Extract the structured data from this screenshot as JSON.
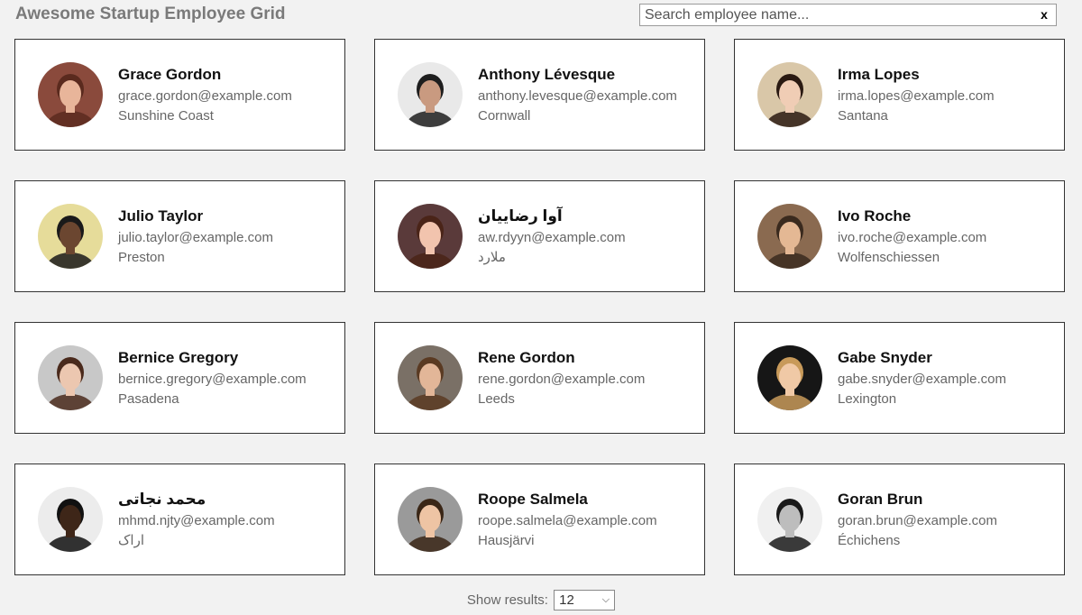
{
  "header": {
    "title": "Awesome Startup Employee Grid",
    "search_placeholder": "Search employee name...",
    "clear_label": "x"
  },
  "employees": [
    {
      "name": "Grace Gordon",
      "email": "grace.gordon@example.com",
      "city": "Sunshine Coast",
      "bg": "#8a4a3c",
      "skin": "#e8b59a",
      "hair": "#5a2a1e"
    },
    {
      "name": "Anthony Lévesque",
      "email": "anthony.levesque@example.com",
      "city": "Cornwall",
      "bg": "#e9e9e9",
      "skin": "#c99a80",
      "hair": "#1e1e1e"
    },
    {
      "name": "Irma Lopes",
      "email": "irma.lopes@example.com",
      "city": "Santana",
      "bg": "#d9c7a8",
      "skin": "#f0cdb5",
      "hair": "#2a1a12"
    },
    {
      "name": "Julio Taylor",
      "email": "julio.taylor@example.com",
      "city": "Preston",
      "bg": "#e6dc9a",
      "skin": "#6b4630",
      "hair": "#1a1a1a"
    },
    {
      "name": "آوا رضاییان",
      "email": "aw.rdyyn@example.com",
      "city": "ملارد",
      "bg": "#5a3a3a",
      "skin": "#f2c4ae",
      "hair": "#4a2418"
    },
    {
      "name": "Ivo Roche",
      "email": "ivo.roche@example.com",
      "city": "Wolfenschiessen",
      "bg": "#8a6a50",
      "skin": "#e4b894",
      "hair": "#3a2a1e"
    },
    {
      "name": "Bernice Gregory",
      "email": "bernice.gregory@example.com",
      "city": "Pasadena",
      "bg": "#c8c8c8",
      "skin": "#ecc7b0",
      "hair": "#4a2a1c"
    },
    {
      "name": "Rene Gordon",
      "email": "rene.gordon@example.com",
      "city": "Leeds",
      "bg": "#7a7066",
      "skin": "#e2b698",
      "hair": "#5a3a22"
    },
    {
      "name": "Gabe Snyder",
      "email": "gabe.snyder@example.com",
      "city": "Lexington",
      "bg": "#161616",
      "skin": "#f0c9a6",
      "hair": "#c89a5a"
    },
    {
      "name": "محمد نجاتی",
      "email": "mhmd.njty@example.com",
      "city": "اراک",
      "bg": "#ececec",
      "skin": "#3e2618",
      "hair": "#111111"
    },
    {
      "name": "Roope Salmela",
      "email": "roope.salmela@example.com",
      "city": "Hausjärvi",
      "bg": "#9a9a9a",
      "skin": "#eec4a4",
      "hair": "#3a2616"
    },
    {
      "name": "Goran Brun",
      "email": "goran.brun@example.com",
      "city": "Échichens",
      "bg": "#f0f0f0",
      "skin": "#bdbdbd",
      "hair": "#1a1a1a"
    }
  ],
  "footer": {
    "show_label": "Show results:",
    "selected_value": "12",
    "chevron_icon": "chevron-down-icon"
  }
}
